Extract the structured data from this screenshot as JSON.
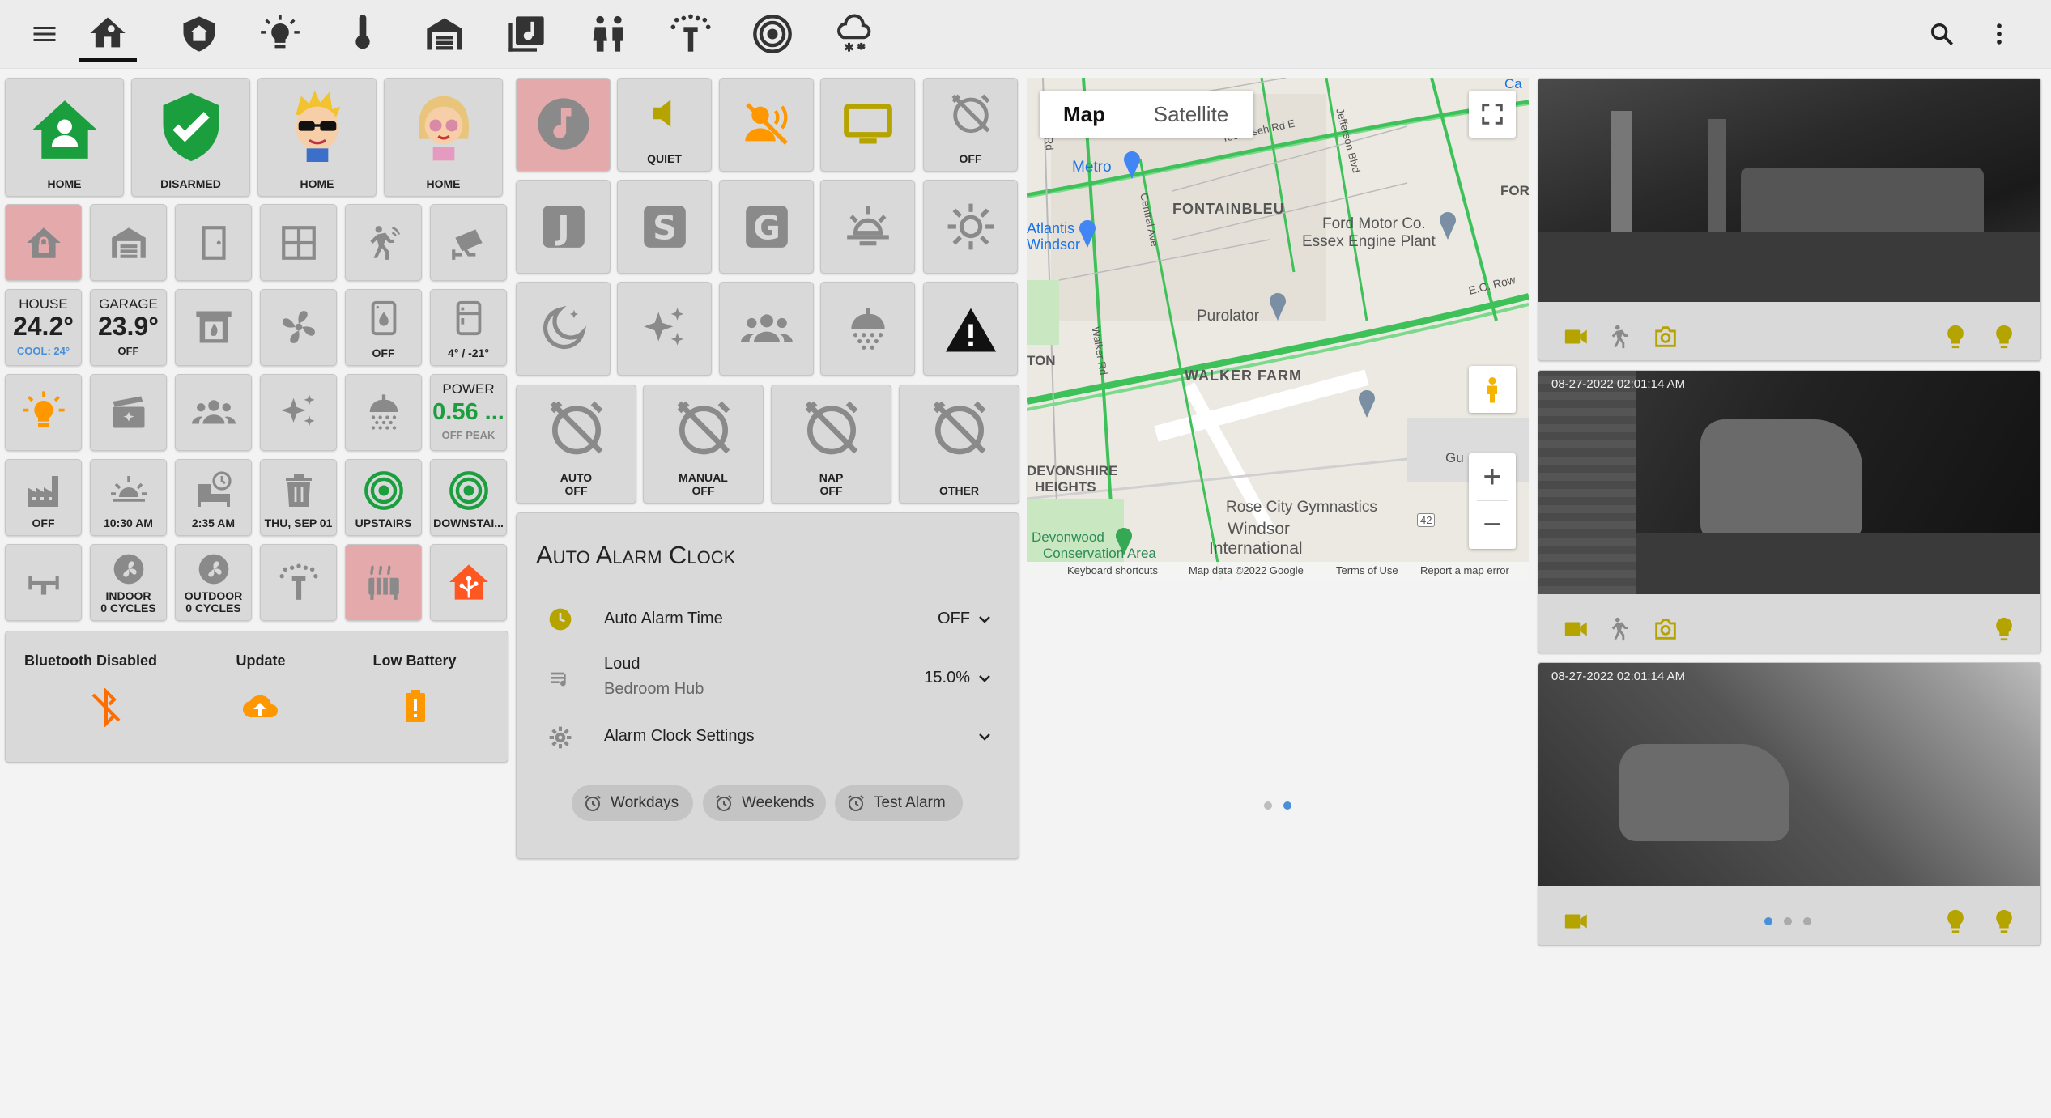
{
  "colors": {
    "accent_yellow": "#b5a300",
    "green": "#1b9e3e",
    "orange": "#ff9800",
    "pink_tile": "#e3a9ab",
    "blue": "#4a90d9"
  },
  "topbar": {
    "icons": [
      "menu-icon",
      "home-icon",
      "house-shield-icon",
      "lightbulb-icon",
      "thermometer-icon",
      "garage-icon",
      "music-library-icon",
      "people-icon",
      "sprinkler-icon",
      "speaker-icon",
      "weather-snow-icon",
      "search-icon",
      "more-vert-icon"
    ]
  },
  "status_row": {
    "home": "HOME",
    "alarm": "DISARMED",
    "person1": "HOME",
    "person2": "HOME"
  },
  "climate": {
    "house_title": "HOUSE",
    "house_temp": "24.2°",
    "house_mode": "COOL: 24°",
    "garage_title": "GARAGE",
    "garage_temp": "23.9°",
    "garage_mode": "OFF",
    "dehumid_label": "OFF",
    "fridge_label": "4° / -21°"
  },
  "power": {
    "title": "POWER",
    "value": "0.56 ...",
    "sub": "OFF PEAK"
  },
  "row_labels": {
    "factory": "OFF",
    "sunrise": "10:30 AM",
    "bed": "2:35 AM",
    "trash": "THU, SEP 01",
    "upstairs": "UPSTAIRS",
    "downstairs": "DOWNSTAI..."
  },
  "hvac": {
    "indoor": "INDOOR",
    "indoor_cycles": "0 CYCLES",
    "outdoor": "OUTDOOR",
    "outdoor_cycles": "0 CYCLES"
  },
  "alerts": [
    {
      "label": "Bluetooth Disabled",
      "icon": "bluetooth-off-icon"
    },
    {
      "label": "Update",
      "icon": "cloud-upload-icon"
    },
    {
      "label": "Low Battery",
      "icon": "battery-alert-icon"
    }
  ],
  "media_tiles": {
    "quiet": "QUIET",
    "alarm_off": "OFF"
  },
  "alarm_tiles": [
    {
      "title": "AUTO",
      "state": "OFF"
    },
    {
      "title": "MANUAL",
      "state": "OFF"
    },
    {
      "title": "NAP",
      "state": "OFF"
    },
    {
      "title": "OTHER",
      "state": ""
    }
  ],
  "alarm_clock": {
    "title": "Auto Alarm Clock",
    "rows": [
      {
        "label": "Auto Alarm Time",
        "sub": "",
        "value": "OFF"
      },
      {
        "label": "Loud",
        "sub": "Bedroom Hub",
        "value": "15.0%"
      },
      {
        "label": "Alarm Clock Settings",
        "sub": "",
        "value": ""
      }
    ],
    "chips": [
      "Workdays",
      "Weekends",
      "Test Alarm"
    ]
  },
  "map": {
    "tab_map": "Map",
    "tab_satellite": "Satellite",
    "places": [
      "Metro",
      "FONTAINBLEU",
      "Ford Motor Co.",
      "Essex Engine Plant",
      "Purolator",
      "WALKER FARM",
      "DEVONSHIRE",
      "HEIGHTS",
      "Rose City Gymnastics",
      "Windsor",
      "International",
      "Devonwood",
      "Conservation Area",
      "Tecumseh Rd E",
      "E.C. Row",
      "Walker Rd",
      "Central Ave",
      "Jefferson Blvd",
      "Dougall Rd",
      "FOR",
      "Gu",
      "ton",
      "Atlantis",
      "Windsor",
      "42",
      "Ca"
    ],
    "footer": [
      "Keyboard shortcuts",
      "Map data ©2022 Google",
      "Terms of Use",
      "Report a map error"
    ],
    "zoom_in": "+",
    "zoom_out": "−"
  },
  "cameras": [
    {
      "timestamp": ""
    },
    {
      "timestamp": "08-27-2022 02:01:14 AM"
    },
    {
      "timestamp": "08-27-2022 02:01:14 AM"
    }
  ]
}
